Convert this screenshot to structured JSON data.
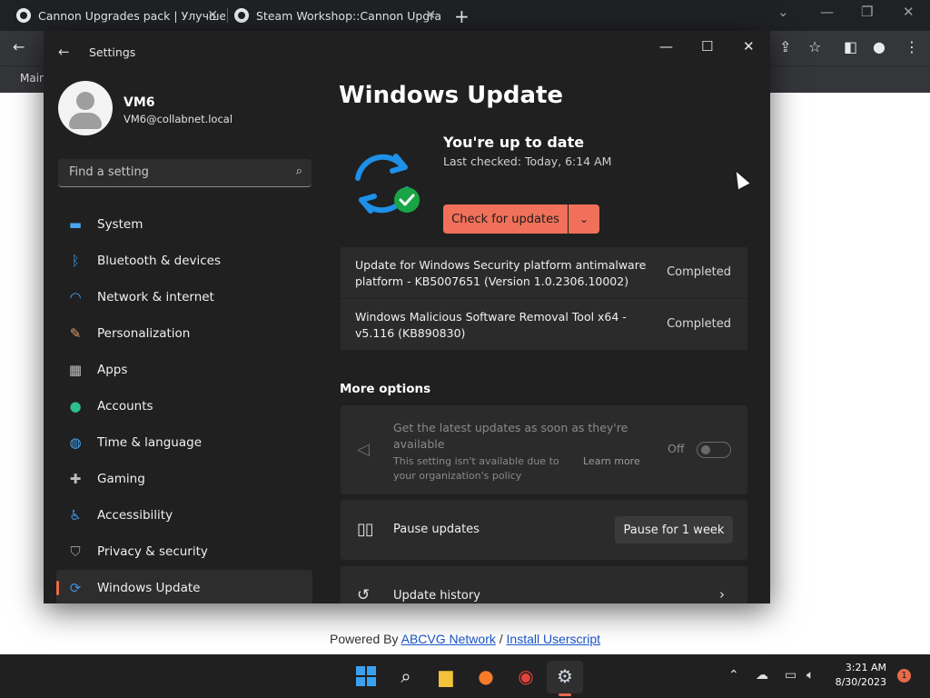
{
  "browser": {
    "tabs": [
      {
        "title": "Cannon Upgrades pack | Улучше"
      },
      {
        "title": "Steam Workshop::Cannon Upgra"
      }
    ],
    "new_tab": "+",
    "bookmark": "Main"
  },
  "footer": {
    "prefix": "Powered By ",
    "link1": "ABCVG Network",
    "sep": " / ",
    "link2": "Install Userscript"
  },
  "window": {
    "app_title": "Settings"
  },
  "profile": {
    "name": "VM6",
    "email": "VM6@collabnet.local"
  },
  "search": {
    "placeholder": "Find a setting"
  },
  "nav": {
    "items": [
      {
        "label": "System",
        "icon": "monitor-icon",
        "color": "#4aa3f0"
      },
      {
        "label": "Bluetooth & devices",
        "icon": "bluetooth-icon",
        "color": "#3b8fe0"
      },
      {
        "label": "Network & internet",
        "icon": "wifi-icon",
        "color": "#4aa3f0"
      },
      {
        "label": "Personalization",
        "icon": "paintbrush-icon",
        "color": "#d9a066"
      },
      {
        "label": "Apps",
        "icon": "apps-icon",
        "color": "#bcbcbc"
      },
      {
        "label": "Accounts",
        "icon": "person-icon",
        "color": "#2fbf8f"
      },
      {
        "label": "Time & language",
        "icon": "globe-clock-icon",
        "color": "#4aa3f0"
      },
      {
        "label": "Gaming",
        "icon": "gamepad-icon",
        "color": "#bcbcbc"
      },
      {
        "label": "Accessibility",
        "icon": "accessibility-icon",
        "color": "#3b8fe0"
      },
      {
        "label": "Privacy & security",
        "icon": "shield-icon",
        "color": "#9a9a9a"
      },
      {
        "label": "Windows Update",
        "icon": "sync-icon",
        "color": "#3b8fe0"
      }
    ],
    "active": "Windows Update"
  },
  "main": {
    "title": "Windows Update",
    "status_title": "You're up to date",
    "last_checked": "Last checked: Today, 6:14 AM",
    "check_button": "Check for updates",
    "updates": [
      {
        "name": "Update for Windows Security platform antimalware platform - KB5007651 (Version 1.0.2306.10002)",
        "status": "Completed"
      },
      {
        "name": "Windows Malicious Software Removal Tool x64 - v5.116 (KB890830)",
        "status": "Completed"
      }
    ],
    "more_options": "More options",
    "latest": {
      "title": "Get the latest updates as soon as they're available",
      "note": "This setting isn't available due to your organization's policy",
      "learn_more": "Learn more",
      "toggle_label": "Off"
    },
    "pause": {
      "label": "Pause updates",
      "button": "Pause for 1 week"
    },
    "history": {
      "label": "Update history"
    }
  },
  "taskbar": {
    "time": "3:21 AM",
    "date": "8/30/2023",
    "notifications": "1"
  },
  "colors": {
    "accent": "#f0705a",
    "nav_active_bar": "#e86a4a",
    "background": "#202020"
  }
}
